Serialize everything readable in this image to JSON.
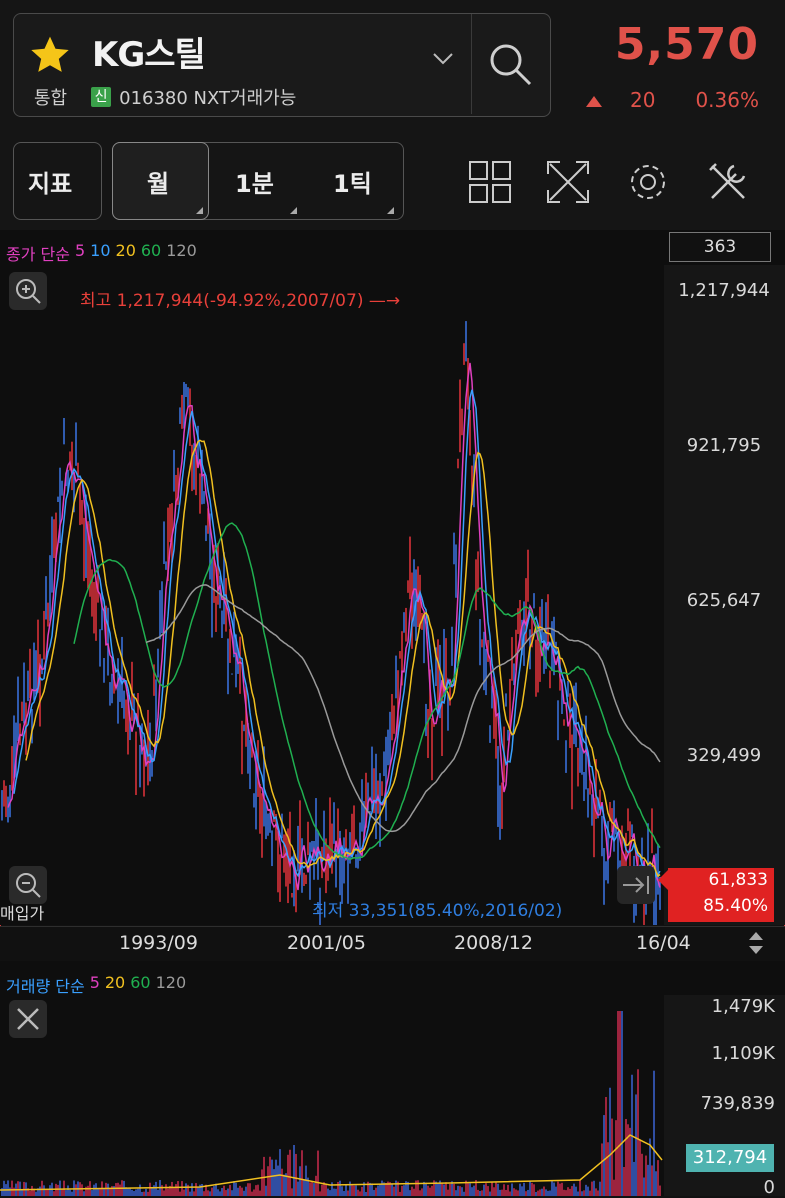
{
  "header": {
    "stock_name": "KG스틸",
    "market": "통합",
    "badge": "신",
    "code_info": "016380 NXT거래가능",
    "price": "5,570",
    "change": "20",
    "change_pct": "0.36%",
    "colors": {
      "up": "#e0524a",
      "star": "#f5c518"
    }
  },
  "toolbar": {
    "indicator_label": "지표",
    "period_tabs": [
      "월",
      "1분",
      "1틱"
    ],
    "icons": [
      "layout-grid-icon",
      "expand-icon",
      "settings-icon",
      "tools-icon"
    ]
  },
  "chart": {
    "legend": {
      "title": "종가 단순",
      "ma": [
        {
          "label": "5",
          "color": "#e040c0"
        },
        {
          "label": "10",
          "color": "#3aa0ff"
        },
        {
          "label": "20",
          "color": "#f0c020"
        },
        {
          "label": "60",
          "color": "#20b050"
        },
        {
          "label": "120",
          "color": "#9a9a9a"
        }
      ]
    },
    "count": "363",
    "y_ticks": [
      "1,217,944",
      "921,795",
      "625,647",
      "329,499"
    ],
    "high_note": "최고 1,217,944(-94.92%,2007/07)",
    "low_note": "최저 33,351(85.40%,2016/02)",
    "buy_label": "매입가",
    "current_value": "61,833",
    "current_pct": "85.40%",
    "x_ticks": [
      "1993/09",
      "2001/05",
      "2008/12",
      "16/04"
    ]
  },
  "volume": {
    "legend": {
      "title": "거래량 단순",
      "ma": [
        {
          "label": "5",
          "color": "#e040c0"
        },
        {
          "label": "20",
          "color": "#f0c020"
        },
        {
          "label": "60",
          "color": "#20b050"
        },
        {
          "label": "120",
          "color": "#9a9a9a"
        }
      ]
    },
    "y_ticks": [
      "1,479K",
      "1,109K",
      "739,839",
      "0"
    ],
    "current_value": "312,794"
  }
}
